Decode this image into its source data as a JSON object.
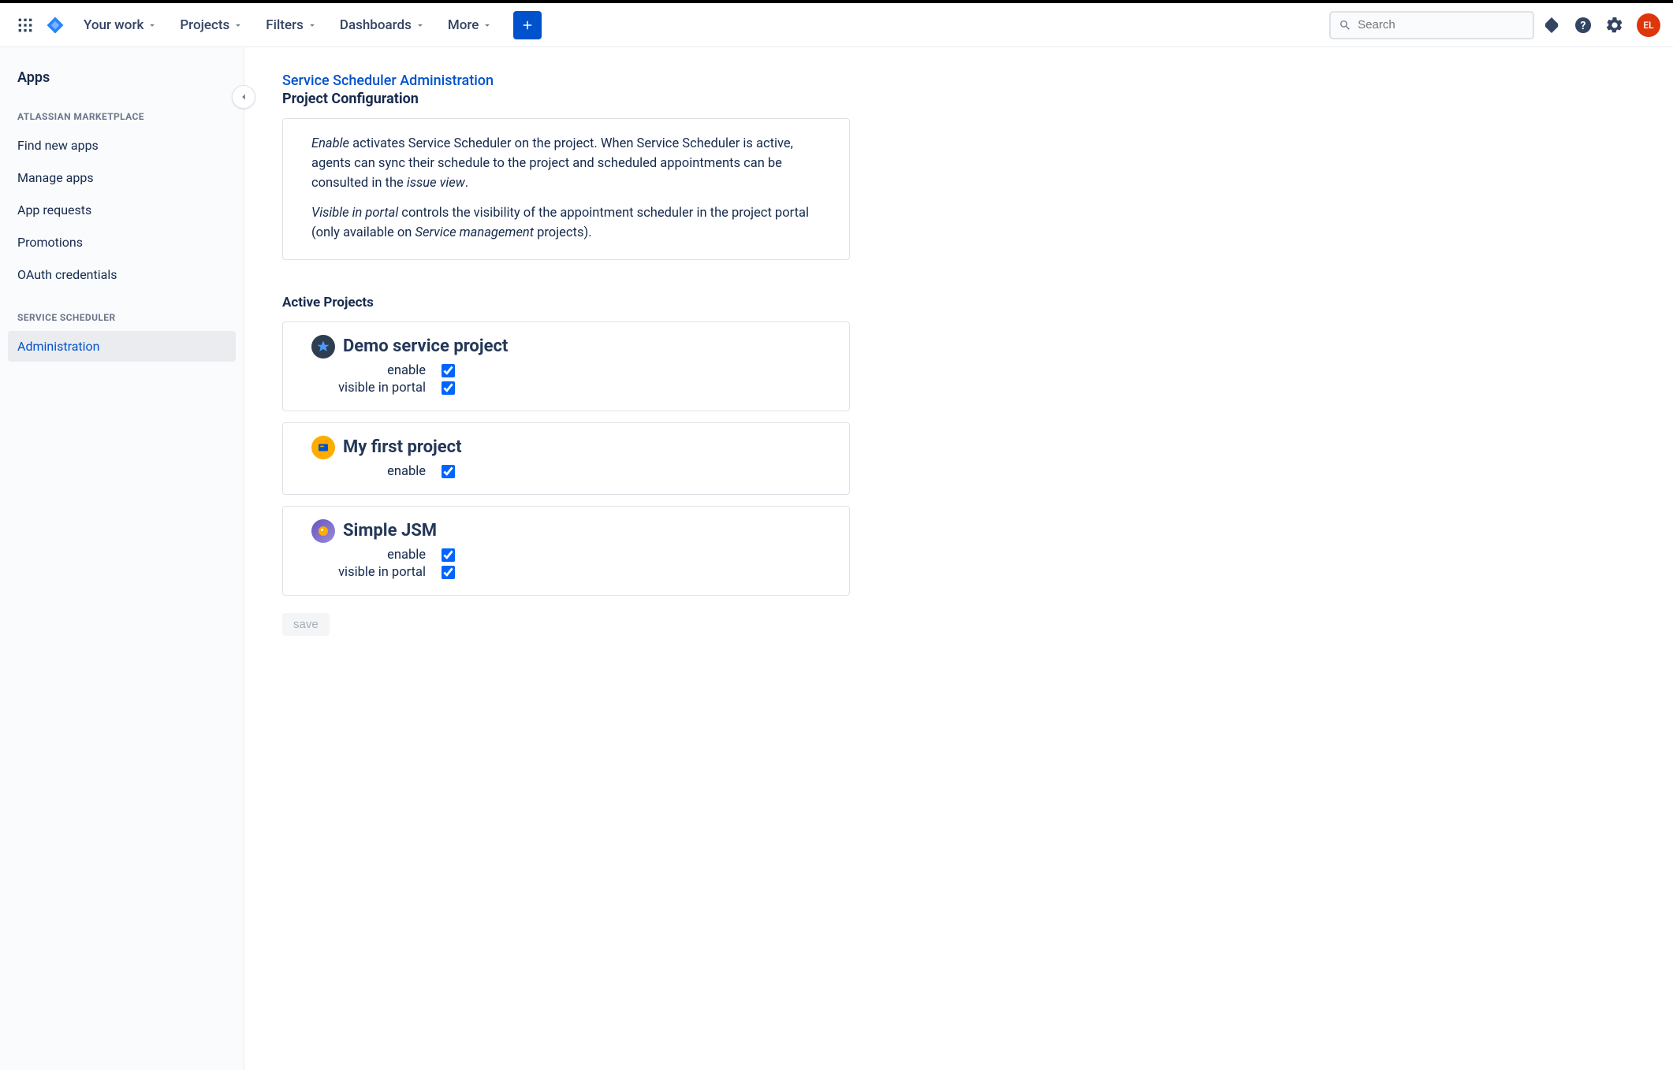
{
  "topnav": {
    "items": [
      {
        "label": "Your work"
      },
      {
        "label": "Projects"
      },
      {
        "label": "Filters"
      },
      {
        "label": "Dashboards"
      },
      {
        "label": "More"
      }
    ],
    "search_placeholder": "Search",
    "avatar_initials": "EL"
  },
  "sidebar": {
    "title": "Apps",
    "sections": [
      {
        "header": "ATLASSIAN MARKETPLACE",
        "items": [
          "Find new apps",
          "Manage apps",
          "App requests",
          "Promotions",
          "OAuth credentials"
        ]
      },
      {
        "header": "SERVICE SCHEDULER",
        "items": [
          "Administration"
        ]
      }
    ]
  },
  "main": {
    "breadcrumb": "Service Scheduler Administration",
    "title": "Project Configuration",
    "info": {
      "p1_em1": "Enable",
      "p1_rest": " activates Service Scheduler on the project. When Service Scheduler is active, agents can sync their schedule to the project and scheduled appointments can be consulted in the ",
      "p1_em2": "issue view",
      "p1_end": ".",
      "p2_em1": "Visible in portal",
      "p2_rest": " controls the visibility of the appointment scheduler in the project portal (only available on ",
      "p2_em2": "Service management",
      "p2_end": " projects)."
    },
    "active_projects_title": "Active Projects",
    "labels": {
      "enable": "enable",
      "visible_in_portal": "visible in portal"
    },
    "projects": [
      {
        "name": "Demo service project",
        "enable": true,
        "visible_in_portal": true,
        "has_portal": true
      },
      {
        "name": "My first project",
        "enable": true,
        "has_portal": false
      },
      {
        "name": "Simple JSM",
        "enable": true,
        "visible_in_portal": true,
        "has_portal": true
      }
    ],
    "save_label": "save"
  }
}
